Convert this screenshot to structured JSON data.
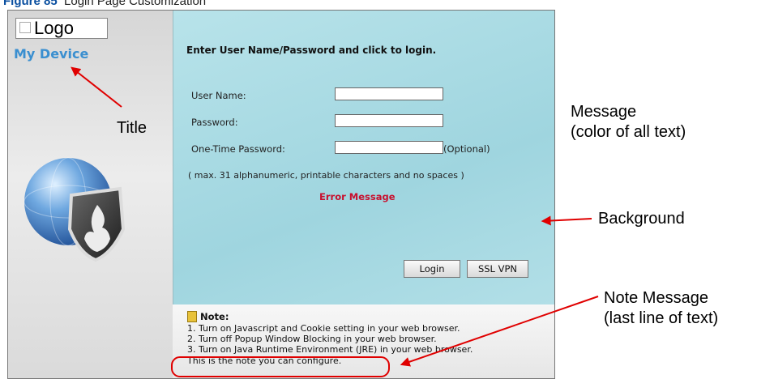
{
  "figure": {
    "number_label": "Figure 85",
    "caption": "Login Page Customization"
  },
  "logo": {
    "text": "Logo"
  },
  "title": "My Device",
  "form": {
    "prompt": "Enter User Name/Password and click to login.",
    "username_label": "User Name:",
    "password_label": "Password:",
    "otp_label": "One-Time Password:",
    "optional_text": "(Optional)",
    "hint": "( max. 31 alphanumeric, printable characters and no spaces )",
    "error": "Error Message",
    "username_value": "",
    "password_value": "",
    "otp_value": ""
  },
  "buttons": {
    "login": "Login",
    "ssl_vpn": "SSL VPN"
  },
  "note": {
    "heading": "Note:",
    "lines": [
      "1. Turn on Javascript and Cookie setting in your web browser.",
      "2. Turn off Popup Window Blocking in your web browser.",
      "3. Turn on Java Runtime Environment (JRE) in your web browser.",
      "This is the note you can configure."
    ]
  },
  "annotations": {
    "title": "Title",
    "message_line1": "Message",
    "message_line2": "(color of all text)",
    "background": "Background",
    "note_line1": "Note Message",
    "note_line2": "(last line of text)"
  },
  "colors": {
    "title": "#3a8fd0",
    "error": "#c8102e",
    "panel_background": "#a8dae3",
    "annotation_arrow": "#e00000"
  },
  "icons": [
    "image-placeholder-icon",
    "globe-shield-icon",
    "note-icon"
  ]
}
